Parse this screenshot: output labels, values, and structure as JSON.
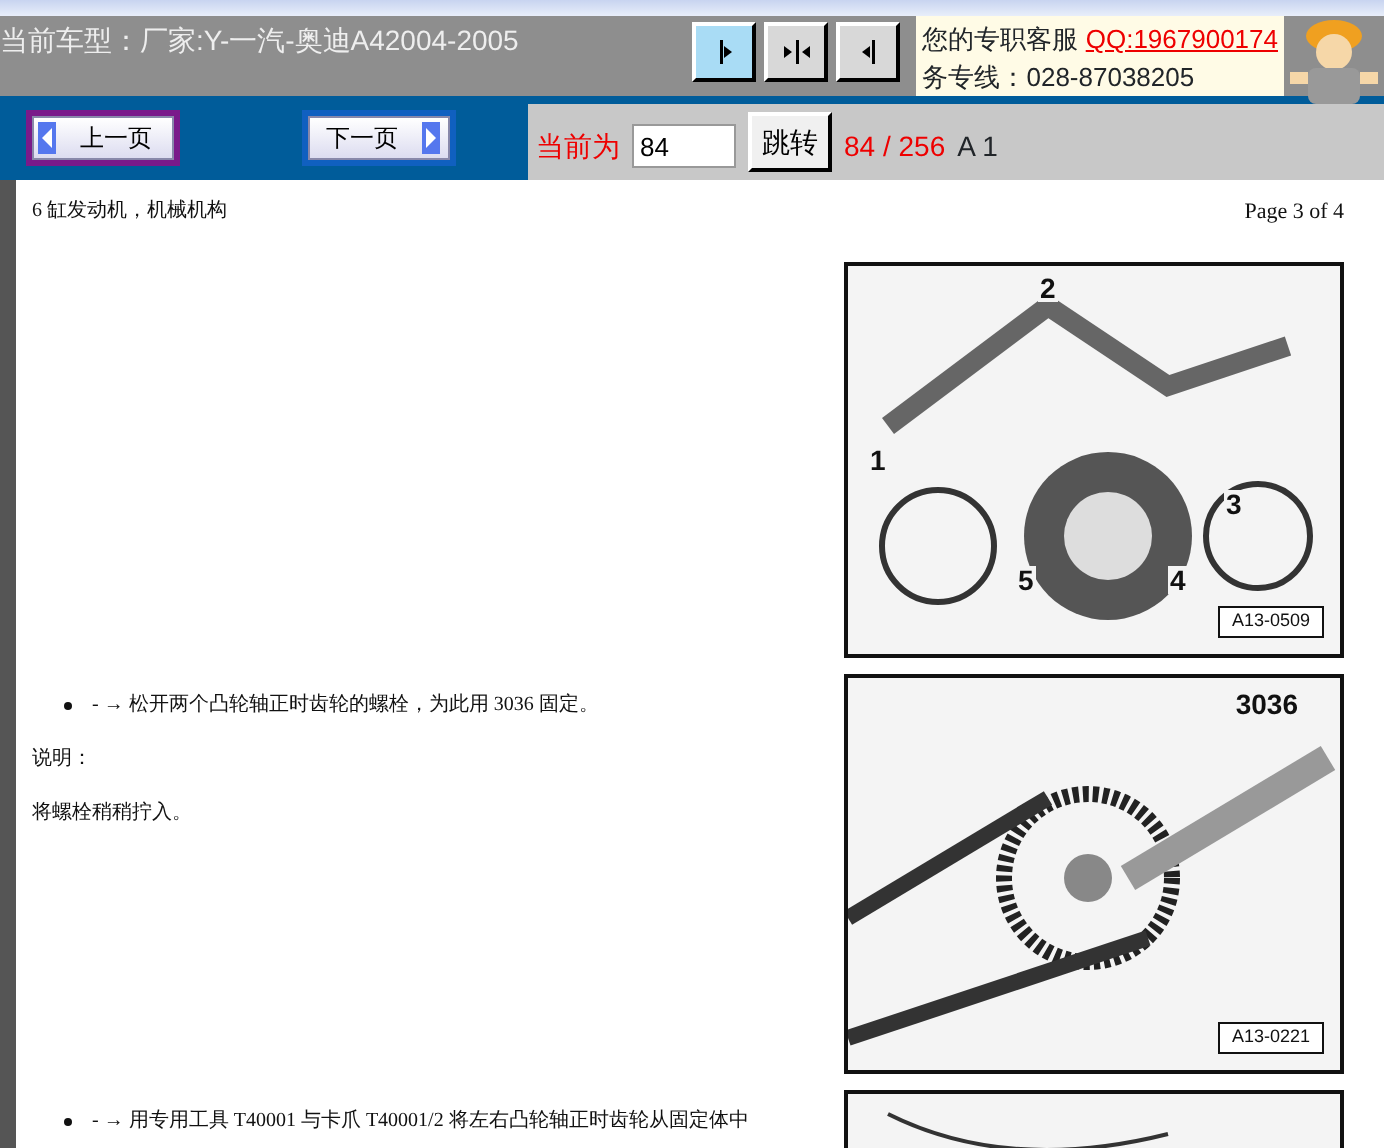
{
  "header": {
    "vehicle_label": "当前车型：厂家:Y-一汽-奥迪A42004-2005",
    "view_buttons": [
      {
        "kind": "right",
        "selected": true
      },
      {
        "kind": "split",
        "selected": false
      },
      {
        "kind": "left",
        "selected": false
      }
    ],
    "service": {
      "text": "您的专职客服",
      "qq": "QQ:1967900174",
      "hotline": "务专线：028-87038205"
    }
  },
  "nav": {
    "buttons": [
      {
        "kind": "prev",
        "label": "上一页",
        "focused": true
      },
      {
        "kind": "next",
        "label": "下一页",
        "focused": false
      }
    ],
    "current_label": "当前为",
    "page_input": "84",
    "jump": "跳转",
    "page_count": "84 / 256",
    "section": "A 1"
  },
  "document": {
    "title": "6 缸发动机，机械机构",
    "page": "Page 3 of 4",
    "rows": [
      {
        "figure": {
          "kind": "engine",
          "callouts": [
            "1",
            "2",
            "3",
            "4",
            "5"
          ],
          "code": "A13-0509"
        }
      },
      {
        "texts": [
          {
            "kind": "bullet",
            "text": "- → 松开两个凸轮轴正时齿轮的螺栓，为此用  3036 固定。"
          },
          {
            "kind": "para",
            "text": "说明："
          },
          {
            "kind": "para",
            "text": "将螺栓稍稍拧入。"
          }
        ],
        "figure": {
          "kind": "sprocket",
          "tool": "3036",
          "code": "A13-0221"
        }
      },
      {
        "texts": [
          {
            "kind": "bullet",
            "text": "- → 用专用工具  T40001 与卡爪  T40001/2 将左右凸轮轴正时齿轮从固定体中"
          }
        ],
        "figure": {
          "kind": "partial"
        }
      }
    ]
  }
}
